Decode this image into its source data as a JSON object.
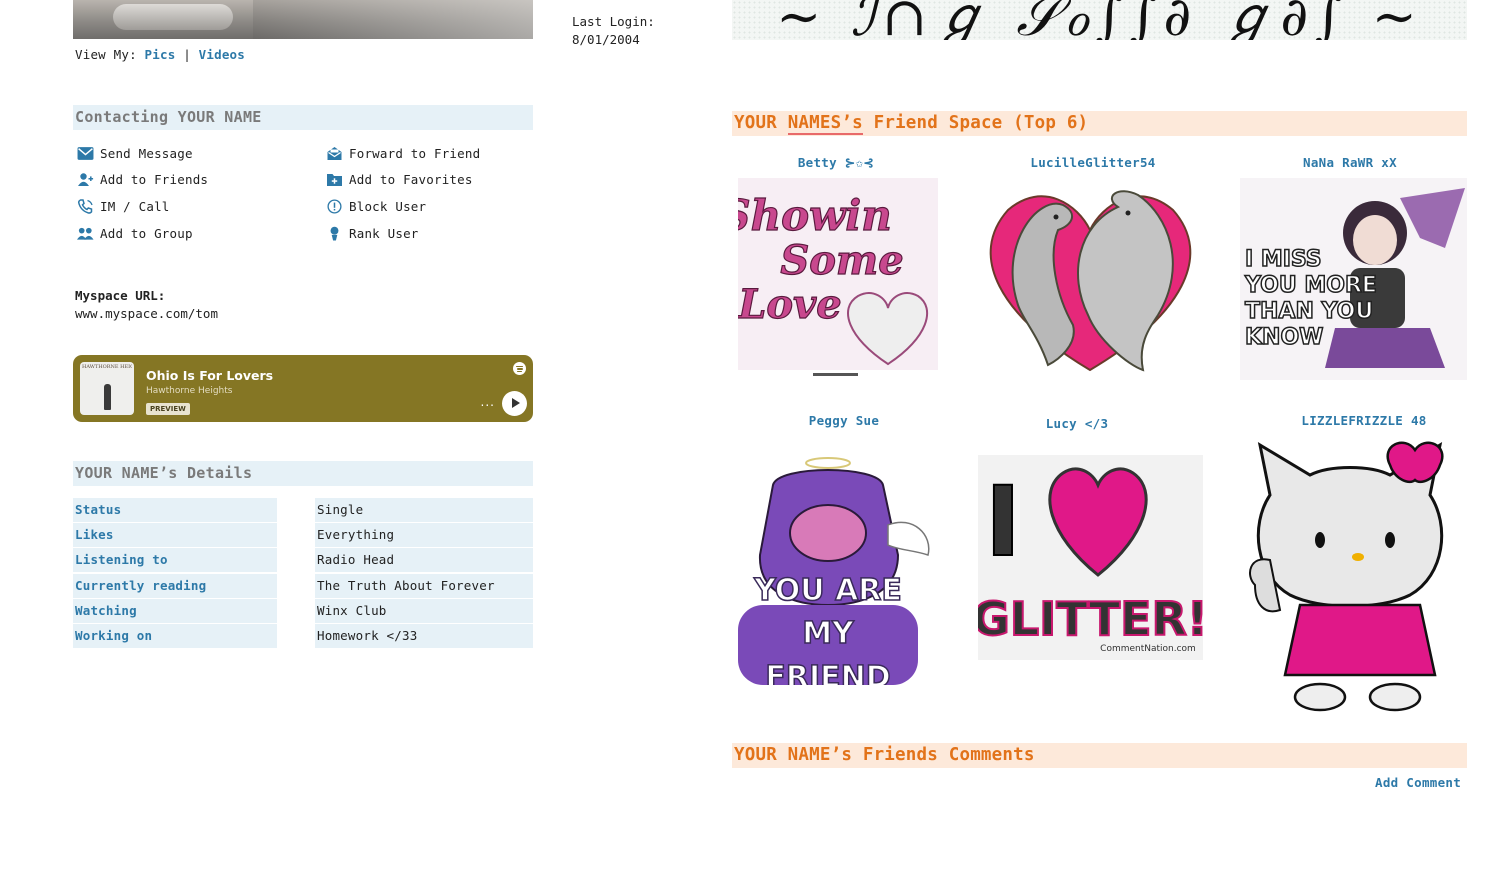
{
  "view_my": {
    "prefix": "View My:",
    "pics": "Pics",
    "separator": "|",
    "videos": "Videos"
  },
  "last_login": {
    "label": "Last Login:",
    "date": "8/01/2004"
  },
  "contacting": {
    "title": "Contacting YOUR NAME",
    "actions": [
      {
        "label": "Send Message",
        "icon": "envelope-icon"
      },
      {
        "label": "Forward to Friend",
        "icon": "forward-mail-icon"
      },
      {
        "label": "Add to Friends",
        "icon": "add-user-icon"
      },
      {
        "label": "Add to Favorites",
        "icon": "add-folder-icon"
      },
      {
        "label": "IM / Call",
        "icon": "phone-icon"
      },
      {
        "label": "Block User",
        "icon": "block-icon"
      },
      {
        "label": "Add to Group",
        "icon": "group-icon"
      },
      {
        "label": "Rank User",
        "icon": "person-icon"
      }
    ]
  },
  "myspace_url": {
    "label": "Myspace URL:",
    "value": "www.myspace.com/tom"
  },
  "music": {
    "title": "Ohio Is For Lovers",
    "artist": "Hawthorne Heights",
    "badge": "PREVIEW",
    "album_text": "HAWTHORNE HEIGHTS",
    "more": "...",
    "background": "#857624"
  },
  "details": {
    "title": "YOUR NAME’s Details",
    "rows": [
      {
        "label": "Status",
        "value": "Single"
      },
      {
        "label": "Likes",
        "value": "Everything"
      },
      {
        "label": "Listening to",
        "value": "Radio Head"
      },
      {
        "label": "Currently reading",
        "value": "The Truth About Forever"
      },
      {
        "label": "Watching",
        "value": "Winx Club"
      },
      {
        "label": "Working on",
        "value": "Homework </33"
      }
    ]
  },
  "friend_space": {
    "title_pre": "YOUR ",
    "title_underlined": "NAMES’s",
    "title_post": " Friend Space (Top 6)",
    "friends": [
      {
        "name": "Betty ⊱✩⊰",
        "graphic_text": [
          "Showin",
          "Some",
          "Love"
        ]
      },
      {
        "name": "LucilleGlitter54"
      },
      {
        "name": "NaNa RaWR xX",
        "graphic_text": [
          "I MISS",
          "YOU MORE",
          "THAN YOU",
          "KNOW"
        ]
      },
      {
        "name": "Peggy Sue",
        "graphic_text": [
          "YOU ARE",
          "MY",
          "FRIEND"
        ]
      },
      {
        "name": "Lucy </3",
        "graphic_text": [
          "I",
          "GLITTER!",
          "CommentNation.com"
        ]
      },
      {
        "name": "LIZZLEFRIZZLE 48"
      }
    ]
  },
  "comments": {
    "title": "YOUR NAME’s Friends Comments",
    "add_comment": "Add Comment"
  },
  "colors": {
    "link": "#2d79a8",
    "accent_orange": "#e2731a",
    "header_blue_bg": "#e6f1f7",
    "header_orange_bg": "#fde9da"
  }
}
